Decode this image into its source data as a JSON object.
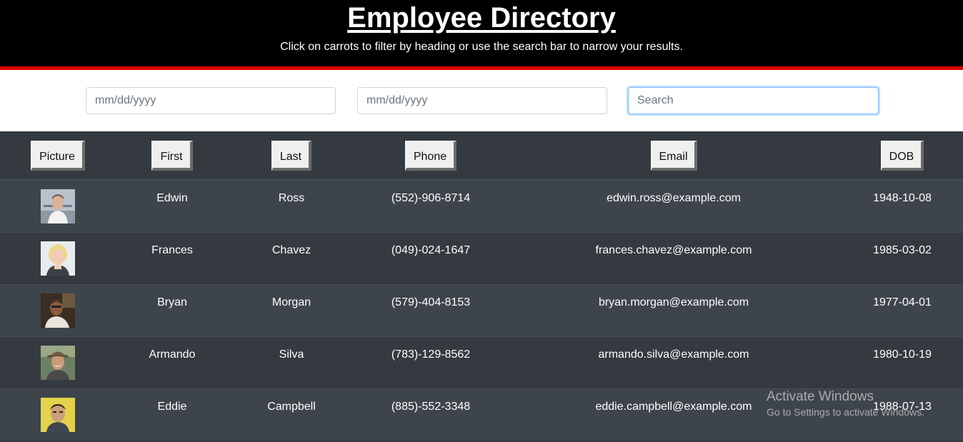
{
  "header": {
    "title": "Employee Directory",
    "subtitle": "Click on carrots to filter by heading or use the search bar to narrow your results.",
    "accent_color": "#e00000"
  },
  "filters": {
    "start_date_placeholder": "mm/dd/yyyy",
    "end_date_placeholder": "mm/dd/yyyy",
    "search_placeholder": "Search"
  },
  "table": {
    "headers": {
      "picture": "Picture",
      "first": "First",
      "last": "Last",
      "phone": "Phone",
      "email": "Email",
      "dob": "DOB"
    },
    "rows": [
      {
        "first": "Edwin",
        "last": "Ross",
        "phone": "(552)-906-8714",
        "email": "edwin.ross@example.com",
        "dob": "1948-10-08"
      },
      {
        "first": "Frances",
        "last": "Chavez",
        "phone": "(049)-024-1647",
        "email": "frances.chavez@example.com",
        "dob": "1985-03-02"
      },
      {
        "first": "Bryan",
        "last": "Morgan",
        "phone": "(579)-404-8153",
        "email": "bryan.morgan@example.com",
        "dob": "1977-04-01"
      },
      {
        "first": "Armando",
        "last": "Silva",
        "phone": "(783)-129-8562",
        "email": "armando.silva@example.com",
        "dob": "1980-10-19"
      },
      {
        "first": "Eddie",
        "last": "Campbell",
        "phone": "(885)-552-3348",
        "email": "eddie.campbell@example.com",
        "dob": "1988-07-13"
      }
    ]
  },
  "watermark": {
    "line1": "Activate Windows",
    "line2": "Go to Settings to activate Windows."
  }
}
